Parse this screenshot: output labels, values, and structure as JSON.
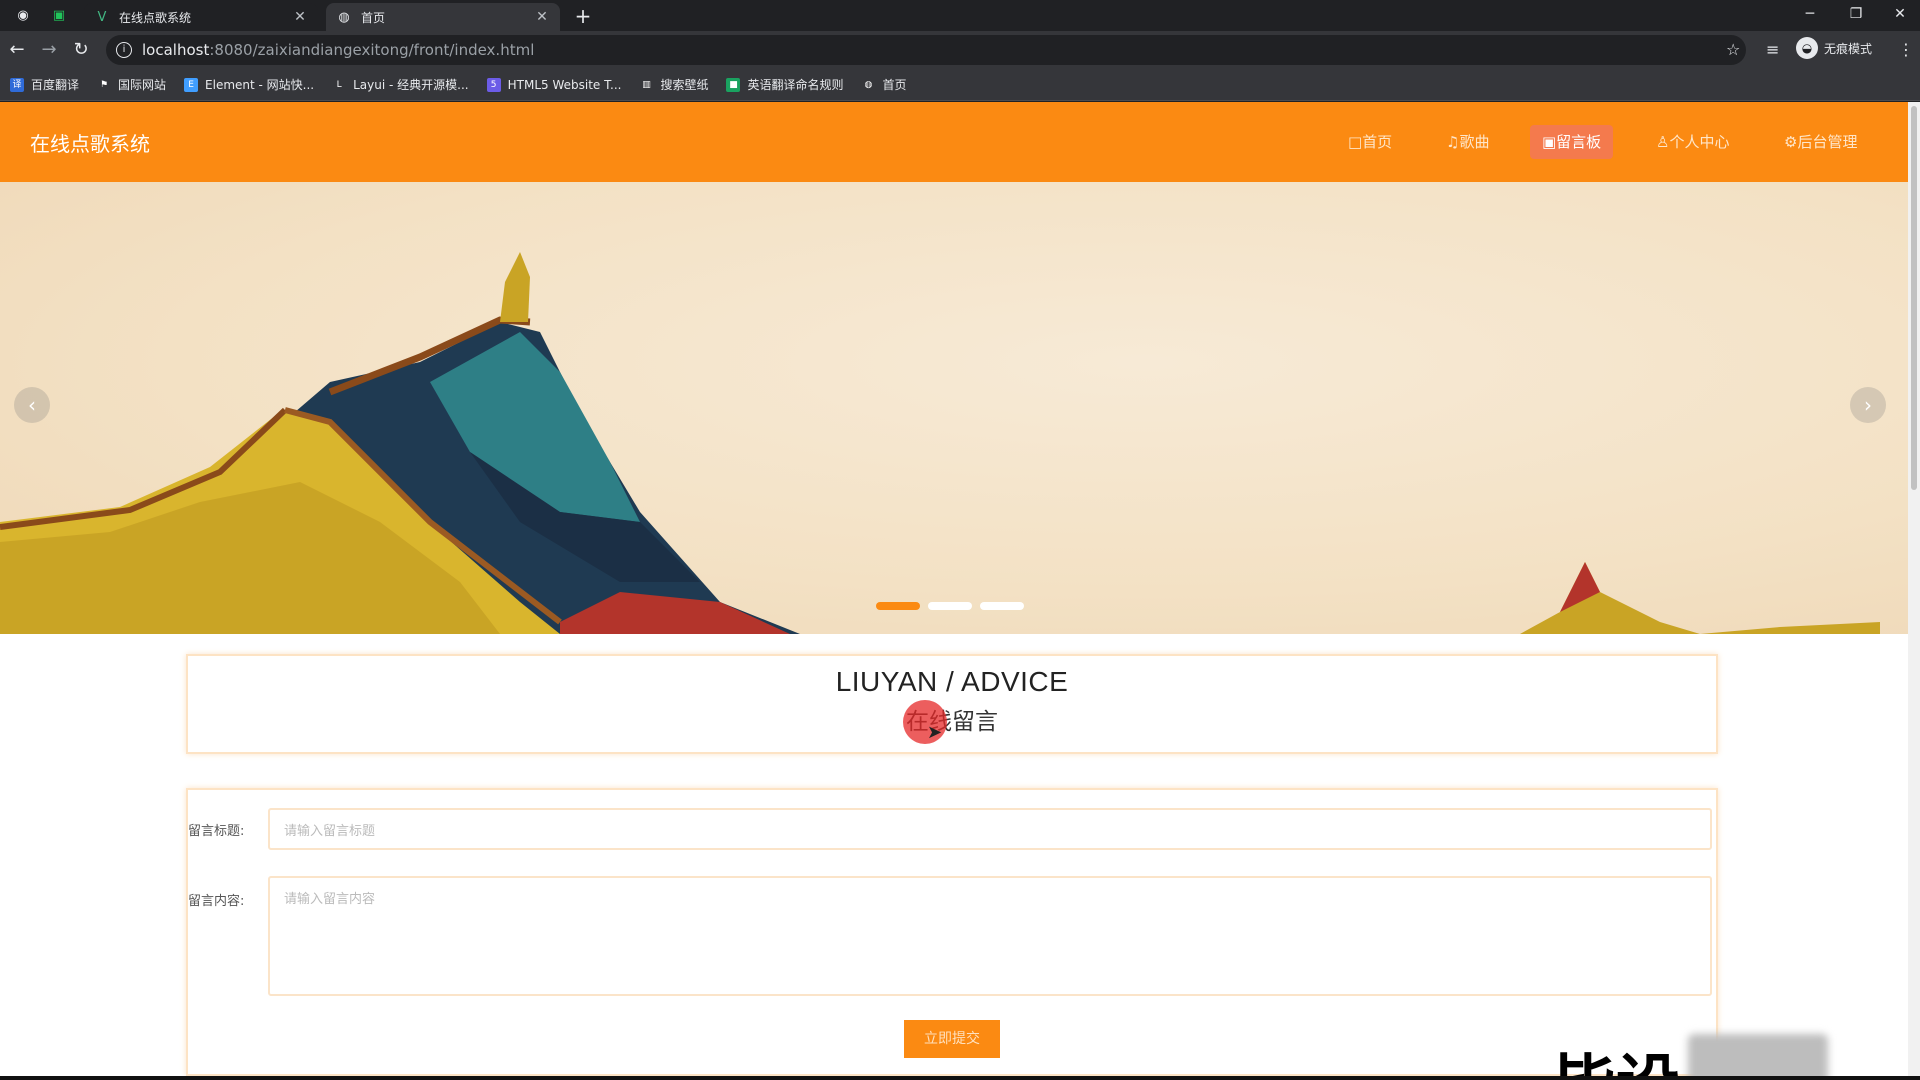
{
  "browser": {
    "tabs": [
      {
        "title": "在线点歌系统"
      },
      {
        "title": "首页"
      }
    ],
    "url": {
      "host": "localhost",
      "path": ":8080/zaixiandiangexitong/front/index.html"
    },
    "profile_label": "无痕模式",
    "bookmarks": [
      {
        "label": "百度翻译",
        "icon": "baidu-translate-icon",
        "color": "#2f6bd8"
      },
      {
        "label": "国际网站",
        "icon": "flag-icon",
        "color": "#35363a"
      },
      {
        "label": "Element - 网站快...",
        "icon": "element-icon",
        "color": "#409eff"
      },
      {
        "label": "Layui - 经典开源模...",
        "icon": "layui-icon",
        "color": "#35363a"
      },
      {
        "label": "HTML5 Website T...",
        "icon": "html5-icon",
        "color": "#6c5ce7"
      },
      {
        "label": "搜索壁纸",
        "icon": "wallpaper-icon",
        "color": "#35363a"
      },
      {
        "label": "英语翻译命名规则",
        "icon": "translate-icon",
        "color": "#1aa260"
      },
      {
        "label": "首页",
        "icon": "globe-icon",
        "color": "#35363a"
      }
    ]
  },
  "site": {
    "logo": "在线点歌系统",
    "nav": [
      {
        "label": "□首页",
        "active": false
      },
      {
        "label": "♫歌曲",
        "active": false
      },
      {
        "label": "▣留言板",
        "active": true
      },
      {
        "label": "♙个人中心",
        "active": false
      },
      {
        "label": "⚙后台管理",
        "active": false
      }
    ]
  },
  "section": {
    "title_en": "LIUYAN / ADVICE",
    "title_cn": "在线留言"
  },
  "form": {
    "title_label": "留言标题:",
    "title_placeholder": "请输入留言标题",
    "content_label": "留言内容:",
    "content_placeholder": "请输入留言内容",
    "submit_label": "立即提交"
  },
  "carousel": {
    "slide_count": 3,
    "active_index": 0
  },
  "overlay": {
    "watermark_text": "毕设"
  },
  "colors": {
    "brand": "#fb8a12",
    "nav_active": "#f47a4d",
    "border": "#fde3c4"
  }
}
